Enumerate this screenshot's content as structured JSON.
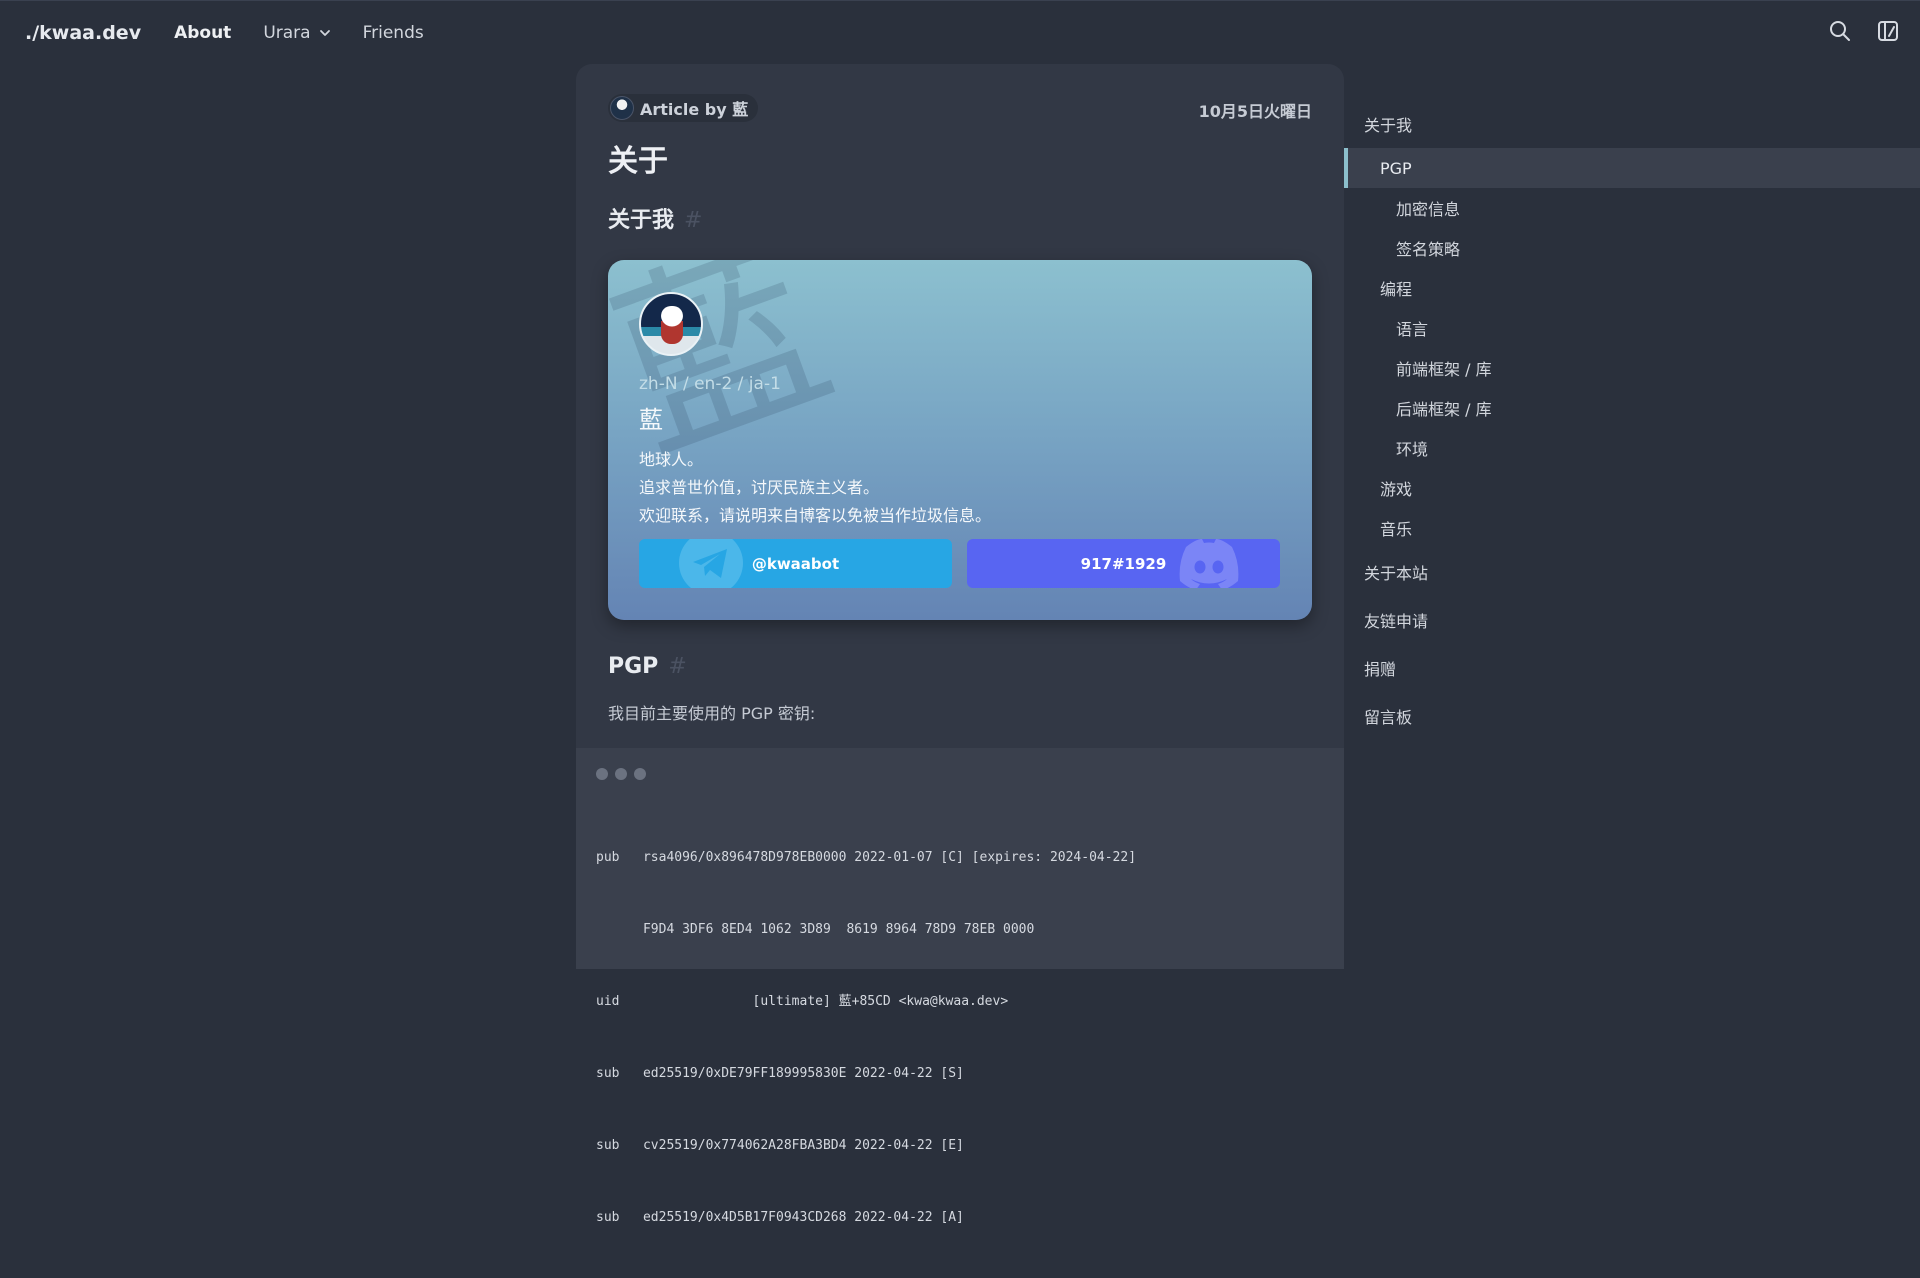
{
  "nav": {
    "brand": "./kwaa.dev",
    "links": [
      {
        "label": "About"
      },
      {
        "label": "Urara"
      },
      {
        "label": "Friends"
      }
    ]
  },
  "article": {
    "author_label": "Article by 藍",
    "date": "10月5日火曜日",
    "title": "关于",
    "section_about_me": "关于我",
    "section_pgp": "PGP",
    "hash": "#",
    "pgp_intro": "我目前主要使用的 PGP 密钥:"
  },
  "profile": {
    "watermark": "藍",
    "langs": "zh-N / en-2 / ja-1",
    "name": "藍",
    "bio": [
      "地球人。",
      "追求普世价值，讨厌民族主义者。",
      "欢迎联系，请说明来自博客以免被当作垃圾信息。"
    ],
    "telegram": "@kwaabot",
    "discord": "917#1929",
    "colors": {
      "telegram": "#27a6e4",
      "discord": "#5865f2"
    }
  },
  "code": {
    "lines": [
      "pub   rsa4096/0x896478D978EB0000 2022-01-07 [C] [expires: 2024-04-22]",
      "      F9D4 3DF6 8ED4 1062 3D89  8619 8964 78D9 78EB 0000",
      "uid                 [ultimate] 藍+85CD <kwa@kwaa.dev>",
      "sub   ed25519/0xDE79FF189995830E 2022-04-22 [S]",
      "sub   cv25519/0x774062A28FBA3BD4 2022-04-22 [E]",
      "sub   ed25519/0x4D5B17F0943CD268 2022-04-22 [A]"
    ]
  },
  "toc": [
    {
      "label": "关于我",
      "level": 1
    },
    {
      "label": "PGP",
      "level": 2,
      "active": true
    },
    {
      "label": "加密信息",
      "level": 3
    },
    {
      "label": "签名策略",
      "level": 3
    },
    {
      "label": "编程",
      "level": 2
    },
    {
      "label": "语言",
      "level": 3
    },
    {
      "label": "前端框架 / 库",
      "level": 3
    },
    {
      "label": "后端框架 / 库",
      "level": 3
    },
    {
      "label": "环境",
      "level": 3
    },
    {
      "label": "游戏",
      "level": 2
    },
    {
      "label": "音乐",
      "level": 2
    },
    {
      "label": "关于本站",
      "level": 1
    },
    {
      "label": "友链申请",
      "level": 1
    },
    {
      "label": "捐赠",
      "level": 1
    },
    {
      "label": "留言板",
      "level": 1
    }
  ],
  "icons": {
    "search": "search-icon",
    "theme": "theme-icon",
    "chevron": "chevron-down-icon",
    "telegram": "telegram-icon",
    "discord": "discord-icon"
  }
}
